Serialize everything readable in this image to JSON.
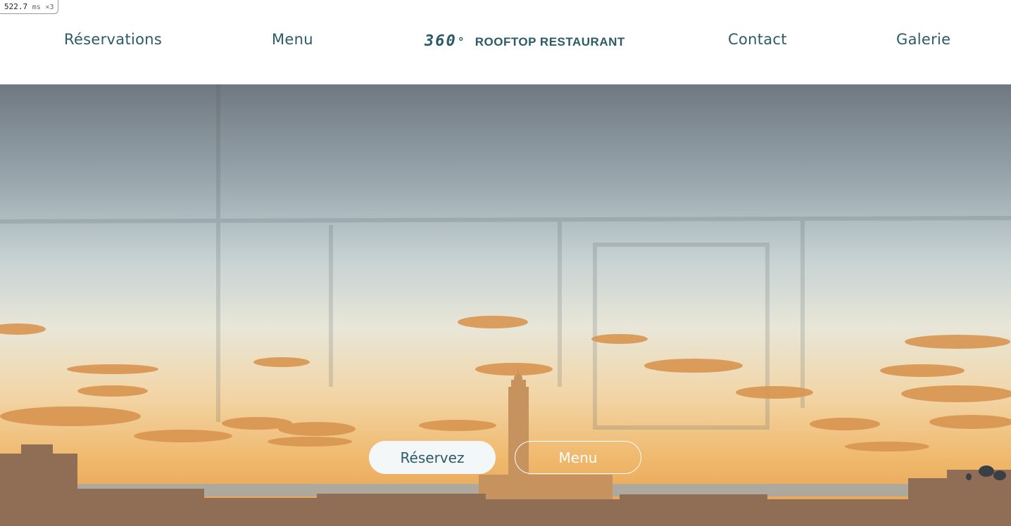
{
  "perf": {
    "value": "522.7",
    "unit": "ms",
    "multiplier": "×3"
  },
  "nav": {
    "reservations": "Réservations",
    "menu": "Menu",
    "contact": "Contact",
    "gallery": "Galerie"
  },
  "brand": {
    "number": "360",
    "degree": "°",
    "name": "ROOFTOP RESTAURANT"
  },
  "hero": {
    "image": "casablanca-skyline-sunset-with-mosque",
    "buttons": {
      "reserve": "Réservez",
      "menu": "Menu"
    }
  },
  "colors": {
    "brand": "#2c5b68",
    "button_bg": "#f4f7f8",
    "header_bg": "#ffffff"
  }
}
